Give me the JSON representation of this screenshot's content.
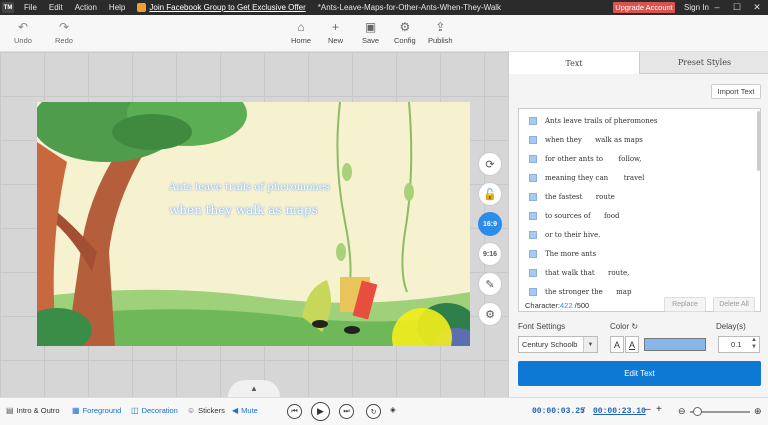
{
  "titlebar": {
    "logo": "TM",
    "menus": [
      "File",
      "Edit",
      "Action",
      "Help"
    ],
    "promo": "Join Facebook Group to Get Exclusive Offer",
    "doc_title": "*Ants-Leave-Maps-for-Other-Ants-When-They-Walk",
    "upgrade": "Upgrade Account",
    "signin": "Sign In",
    "minimize": "–",
    "maximize": "☐",
    "close": "✕"
  },
  "toolbar": {
    "undo": "Undo",
    "redo": "Redo",
    "home": "Home",
    "new": "New",
    "save": "Save",
    "config": "Config",
    "publish": "Publish"
  },
  "canvas": {
    "caption_line1": "Ants leave trails of pheromones",
    "caption_line2": "when they walk as maps",
    "ratio_169": "16:9",
    "ratio_916": "9:16"
  },
  "panel": {
    "tab_text": "Text",
    "tab_preset": "Preset Styles",
    "import_text": "Import Text",
    "items": [
      "Ants leave trails of pheromones",
      "when they      walk as maps",
      "for other ants to       follow,",
      "meaning they can       travel",
      "the fastest      route",
      "to sources of      food",
      "or to their hive.",
      "The more ants",
      "that walk that      route,",
      "the stronger the      map"
    ],
    "character_label": "Character:",
    "character_count": "422",
    "character_max": " /500",
    "replace": "Replace",
    "delete_all": "Delete All",
    "font_settings": "Font Settings",
    "color_label": "Color",
    "delay_label": "Delay(s)",
    "font_value": "Century Schoolb",
    "delay_value": "0.1",
    "edit_text": "Edit Text"
  },
  "bottom": {
    "intro_outro": "Intro & Outro",
    "foreground": "Foreground",
    "decoration": "Decoration",
    "stickers": "Stickers",
    "mute": "Mute",
    "current_time": "00:00:03.25",
    "separator": " / ",
    "total_time": "00:00:23.10",
    "minus": "–",
    "plus": "+"
  },
  "colors": {
    "accent": "#0e78d5",
    "upgrade": "#d9534f",
    "text_color_swatch": "#89b6ea"
  }
}
